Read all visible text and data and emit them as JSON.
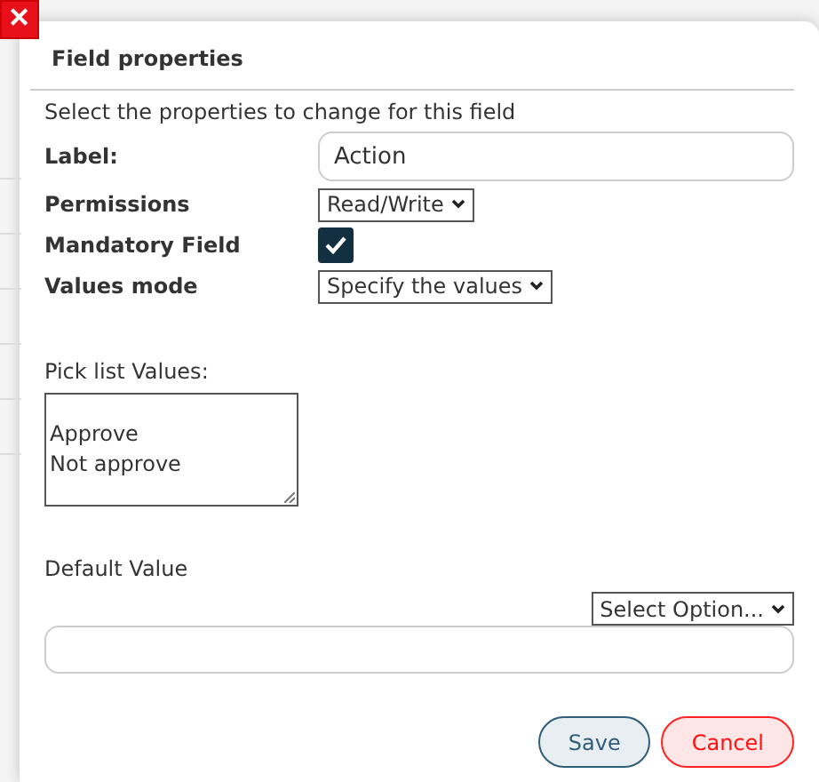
{
  "close_button": {
    "label": "✕"
  },
  "dialog": {
    "title": "Field properties",
    "intro": "Select the properties to change for this field"
  },
  "fields": [
    {
      "kind": "text",
      "label": "Label:",
      "value": "Action"
    },
    {
      "kind": "select",
      "label": "Permissions",
      "value": "Read/Write"
    },
    {
      "kind": "checkbox",
      "label": "Mandatory Field",
      "checked": true
    },
    {
      "kind": "select",
      "label": "Values mode",
      "value": "Specify the values"
    }
  ],
  "picklist": {
    "label": "Pick list Values:",
    "lines": [
      "Approve",
      "Not approve"
    ]
  },
  "default_value": {
    "label": "Default Value",
    "select": "Select Option..."
  },
  "buttons": [
    {
      "kind": "save",
      "label": "Save"
    },
    {
      "kind": "cancel",
      "label": "Cancel"
    }
  ]
}
